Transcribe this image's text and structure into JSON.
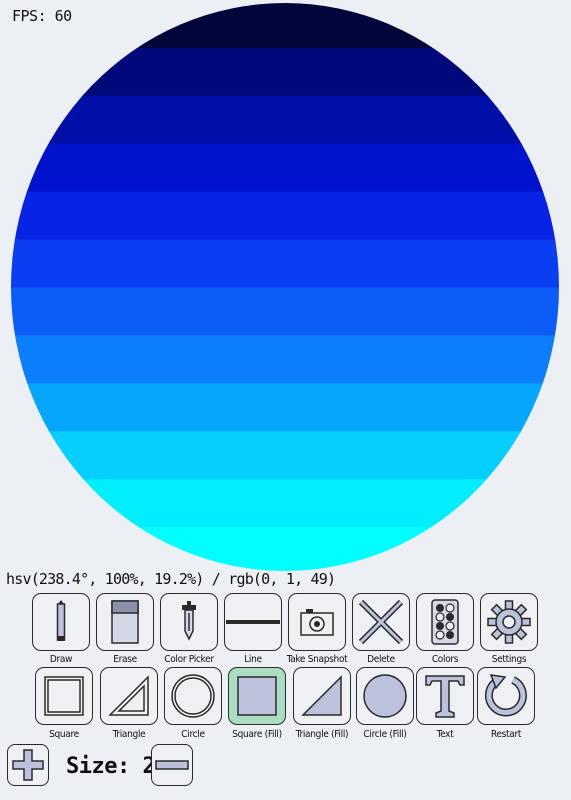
{
  "fps_text": "FPS: 60",
  "status_text": "hsv(238.4°, 100%, 19.2%) / rgb(0, 1, 49)",
  "canvas": {
    "content": "filled-circle-gradient",
    "bands": [
      "#00053a",
      "#00097a",
      "#000fa8",
      "#0013cc",
      "#0724e6",
      "#0a3ef2",
      "#0b5cf8",
      "#0a7efb",
      "#07a6fd",
      "#05cffe",
      "#01eefe",
      "#00ffff"
    ]
  },
  "toolbar": {
    "row1": [
      {
        "id": "draw",
        "label": "Draw",
        "icon": "pencil-icon"
      },
      {
        "id": "erase",
        "label": "Erase",
        "icon": "eraser-icon"
      },
      {
        "id": "color-picker",
        "label": "Color Picker",
        "icon": "dropper-icon"
      },
      {
        "id": "line",
        "label": "Line",
        "icon": "line-icon"
      },
      {
        "id": "take-snapshot",
        "label": "Take Snapshot",
        "icon": "camera-icon"
      },
      {
        "id": "delete",
        "label": "Delete",
        "icon": "x-icon"
      },
      {
        "id": "colors",
        "label": "Colors",
        "icon": "palette-icon"
      },
      {
        "id": "settings",
        "label": "Settings",
        "icon": "gear-icon"
      }
    ],
    "row2": [
      {
        "id": "square",
        "label": "Square",
        "icon": "square-outline-icon"
      },
      {
        "id": "triangle",
        "label": "Triangle",
        "icon": "triangle-outline-icon"
      },
      {
        "id": "circle",
        "label": "Circle",
        "icon": "circle-outline-icon"
      },
      {
        "id": "square-fill",
        "label": "Square (Fill)",
        "icon": "square-fill-icon",
        "selected": true
      },
      {
        "id": "triangle-fill",
        "label": "Triangle (Fill)",
        "icon": "triangle-fill-icon"
      },
      {
        "id": "circle-fill",
        "label": "Circle (Fill)",
        "icon": "circle-fill-icon"
      },
      {
        "id": "text",
        "label": "Text",
        "icon": "text-icon"
      },
      {
        "id": "restart",
        "label": "Restart",
        "icon": "restart-icon"
      }
    ]
  },
  "size": {
    "label": "Size: 2.0",
    "increase_icon": "plus-icon",
    "decrease_icon": "minus-icon"
  },
  "colors": {
    "selected_tool_bg": "#a9dcc0",
    "icon_fill": "#bcc2db",
    "icon_stroke": "#2a2a2a",
    "background": "#eceff3"
  }
}
